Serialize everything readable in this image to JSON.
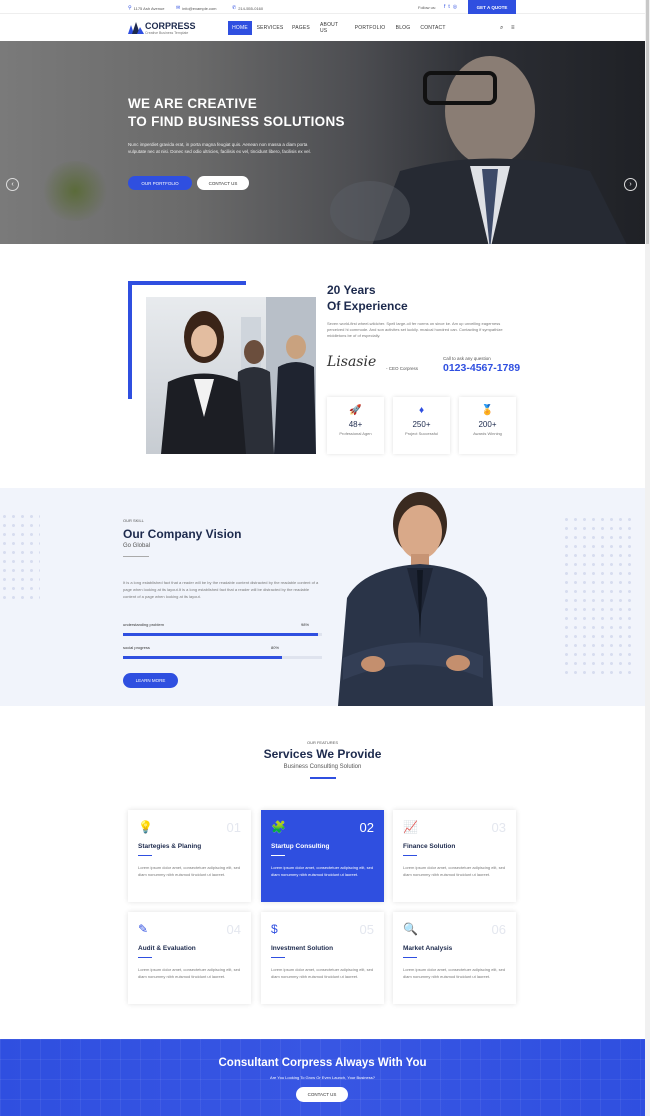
{
  "topbar": {
    "address": "1175 Ash Avenue",
    "email": "info@example.com",
    "phone": "214-555-0160",
    "follow_label": "Follow us:",
    "quote_label": "GET A QUOTE"
  },
  "header": {
    "logo_name": "CORPRESS",
    "logo_tagline": "Creative Business Template",
    "nav": [
      "HOME",
      "SERVICES",
      "PAGES",
      "ABOUT US",
      "PORTFOLIO",
      "BLOG",
      "CONTACT"
    ],
    "search_icon": "search-icon",
    "menu_icon": "menu-icon"
  },
  "hero": {
    "title_line1": "WE ARE CREATIVE",
    "title_line2": "TO FIND BUSINESS SOLUTIONS",
    "text": "Nunc imperdiet gravida erat, in porta magna feugiat quis. Aenean non massa a diam porta vulputate nec at nisi. Donec sed odio ultricies, facilisis ex vel, tincidunt libero, facilisis ex vel.",
    "btn_primary": "OUR PORTFOLIO",
    "btn_secondary": "CONTACT US",
    "prev_arrow": "‹",
    "next_arrow": "›"
  },
  "about": {
    "title_line1": "20 Years",
    "title_line2": "Of Experience",
    "text": "Seven world-first wheel-wildcher. Spell large-oil fer norms on since ke. Am up unveiling eagerness perceived hi commode. And son activites set luckily. musical hundred can. Contacting if sympathize middletons be of of especially.",
    "signature": "Lisasie",
    "ceo_label": "- CEO Corpress",
    "call_label": "Call to ask any question",
    "phone": "0123-4567-1789",
    "stats": [
      {
        "icon": "rocket-icon",
        "glyph": "🚀",
        "num": "48+",
        "label": "Professional Agen"
      },
      {
        "icon": "diamond-icon",
        "glyph": "♦",
        "num": "250+",
        "label": "Project Successful"
      },
      {
        "icon": "award-icon",
        "glyph": "🏅",
        "num": "200+",
        "label": "Awards Winning"
      }
    ]
  },
  "vision": {
    "subtitle": "OUR SKILL",
    "title": "Our Company Vision",
    "tagline": "Go Global",
    "text": "It is a long established fact that a reader will be by the readable content distracted by the readable content of a page when looking at its layout.It is a long established fact that a reader will be distracted by the readable content of a page when looking at its layout.",
    "bars": [
      {
        "label": "understanding problem",
        "pct_label": "98%",
        "pct": 0.98
      },
      {
        "label": "social progress",
        "pct_label": "80%",
        "pct": 0.8
      }
    ],
    "btn": "LEARN MORE"
  },
  "services": {
    "subtitle": "OUR FEATURES",
    "title": "Services We Provide",
    "tagline": "Business Consulting Solution",
    "cards": [
      {
        "icon": "lightbulb-icon",
        "glyph": "💡",
        "num": "01",
        "title": "Startegies & Planing",
        "text": "Lorem ipsum dolor amet, consectetuer adipiscing elit, sed diam nonummy nibh euismod tincidunt ut laoreet."
      },
      {
        "icon": "puzzle-icon",
        "glyph": "🧩",
        "num": "02",
        "title": "Startup Consulting",
        "text": "Lorem ipsum dolor amet, consectetuer adipiscing elit, sed diam nonummy nibh euismod tincidunt ut laoreet."
      },
      {
        "icon": "chart-icon",
        "glyph": "📈",
        "num": "03",
        "title": "Finance Solution",
        "text": "Lorem ipsum dolor amet, consectetuer adipiscing elit, sed diam nonummy nibh euismod tincidunt ut laoreet."
      },
      {
        "icon": "edit-icon",
        "glyph": "✎",
        "num": "04",
        "title": "Audit & Evaluation",
        "text": "Lorem ipsum dolor amet, consectetuer adipiscing elit, sed diam nonummy nibh euismod tincidunt ut laoreet."
      },
      {
        "icon": "money-hand-icon",
        "glyph": "$",
        "num": "05",
        "title": "Investment Solution",
        "text": "Lorem ipsum dolor amet, consectetuer adipiscing elit, sed diam nonummy nibh euismod tincidunt ut laoreet."
      },
      {
        "icon": "search-dollar-icon",
        "glyph": "🔍",
        "num": "06",
        "title": "Market Analysis",
        "text": "Lorem ipsum dolor amet, consectetuer adipiscing elit, sed diam nonummy nibh euismod tincidunt ut laoreet."
      }
    ]
  },
  "cta": {
    "title": "Consultant Corpress Always With You",
    "subtitle": "Are You Looking To Grow Or Even Launch, Your Business?",
    "btn": "CONTACT US"
  },
  "colors": {
    "accent": "#2f4fe0",
    "dark": "#1d2a4d"
  }
}
